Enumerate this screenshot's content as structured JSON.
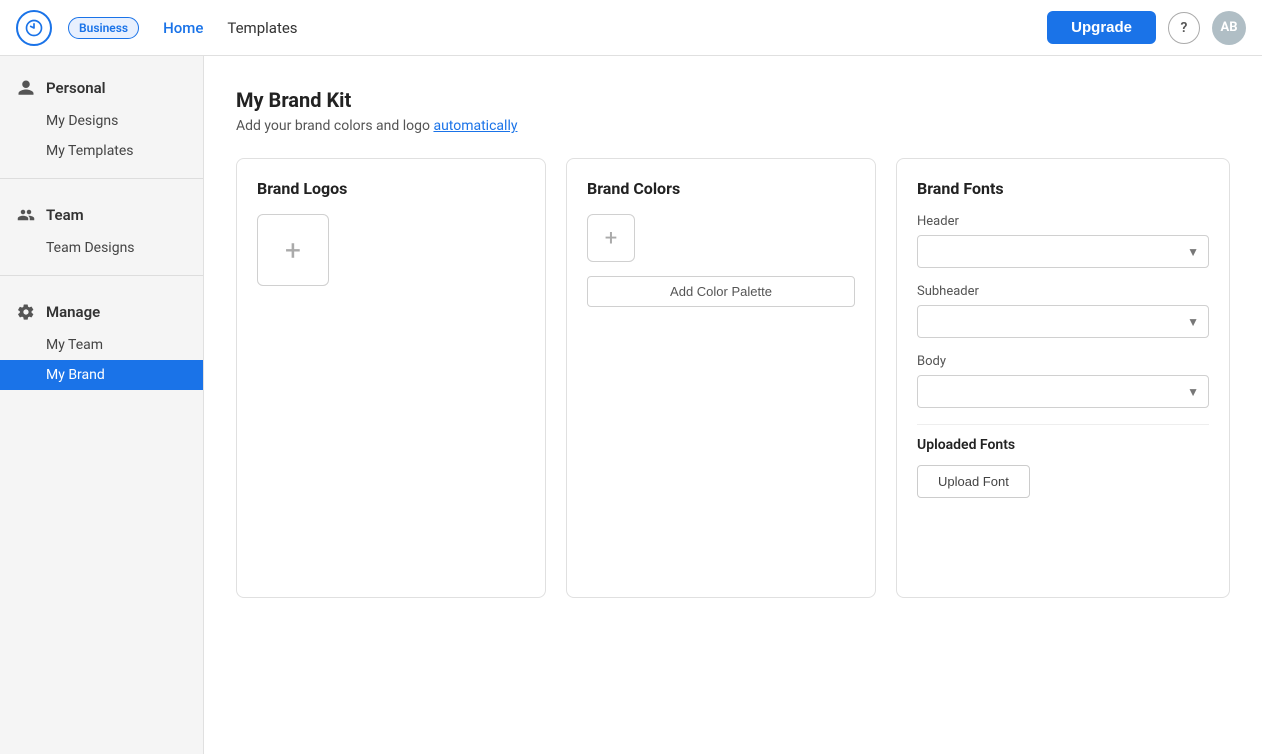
{
  "header": {
    "logo_aria": "App Logo",
    "badge_label": "Business",
    "nav_items": [
      {
        "label": "Home",
        "active": true
      },
      {
        "label": "Templates",
        "active": false
      }
    ],
    "upgrade_label": "Upgrade",
    "help_label": "?",
    "avatar_initials": "AB"
  },
  "sidebar": {
    "sections": [
      {
        "icon": "person",
        "title": "Personal",
        "items": [
          {
            "label": "My Designs",
            "active": false
          },
          {
            "label": "My Templates",
            "active": false
          }
        ]
      },
      {
        "icon": "group",
        "title": "Team",
        "items": [
          {
            "label": "Team Designs",
            "active": false
          }
        ]
      },
      {
        "icon": "gear",
        "title": "Manage",
        "items": [
          {
            "label": "My Team",
            "active": false
          },
          {
            "label": "My Brand",
            "active": true
          }
        ]
      }
    ]
  },
  "main": {
    "page_title": "My Brand Kit",
    "page_subtitle_text": "Add your brand colors and logo ",
    "page_subtitle_link": "automatically",
    "brand_logos": {
      "title": "Brand Logos",
      "add_aria": "+"
    },
    "brand_colors": {
      "title": "Brand Colors",
      "add_aria": "+",
      "add_palette_label": "Add Color Palette"
    },
    "brand_fonts": {
      "title": "Brand Fonts",
      "header_label": "Header",
      "subheader_label": "Subheader",
      "body_label": "Body",
      "uploaded_fonts_title": "Uploaded Fonts",
      "upload_font_label": "Upload Font"
    }
  }
}
